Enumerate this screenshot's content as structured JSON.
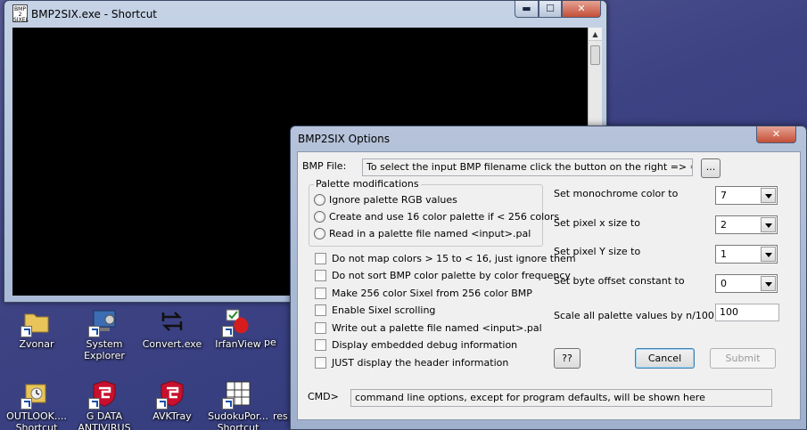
{
  "desktop": {
    "icons": [
      {
        "label": "Zvonar"
      },
      {
        "label": "System Explorer"
      },
      {
        "label": "Convert.exe"
      },
      {
        "label": "IrfanView"
      },
      {
        "label": "OUTLOOK.... Shortcut"
      },
      {
        "label": "G DATA ANTIVIRUS"
      },
      {
        "label": "AVKTray"
      },
      {
        "label": "SudokuPor... Shortcut"
      }
    ],
    "partial_labels": [
      "pe",
      "res",
      "Shortcut"
    ]
  },
  "console_window": {
    "title": "BMP2SIX.exe - Shortcut",
    "app_icon_text": "BMP 2 SIXEL",
    "min_glyph": "▬",
    "max_glyph": "☐",
    "close_glyph": "✕"
  },
  "dialog": {
    "title": "BMP2SIX Options",
    "close_glyph": "✕",
    "bmp_file": {
      "label": "BMP File:",
      "value": "To select the input BMP filename click the button on the right => =>",
      "browse_label": "..."
    },
    "palette_group": {
      "title": "Palette modifications",
      "options": [
        {
          "label": "Ignore palette RGB values"
        },
        {
          "label": "Create and use 16 color palette if < 256 colors"
        },
        {
          "label": "Read in a palette file named <input>.pal"
        }
      ]
    },
    "checkboxes": [
      {
        "label": "Do not map colors > 15 to < 16, just ignore them"
      },
      {
        "label": "Do not sort BMP color palette by color frequency"
      },
      {
        "label": "Make 256 color Sixel from 256 color BMP"
      },
      {
        "label": "Enable Sixel scrolling"
      },
      {
        "label": "Write out a palette file named <input>.pal"
      },
      {
        "label": "Display embedded debug information"
      },
      {
        "label": "JUST display the header information"
      }
    ],
    "settings": [
      {
        "label": "Set monochrome color to",
        "value": "7"
      },
      {
        "label": "Set pixel x size to",
        "value": "2"
      },
      {
        "label": "Set pixel Y size to",
        "value": "1"
      },
      {
        "label": "Set byte offset constant to",
        "value": "0"
      }
    ],
    "scale": {
      "label": "Scale all palette values by n/100",
      "value": "100"
    },
    "buttons": {
      "help": "??",
      "cancel": "Cancel",
      "submit": "Submit"
    },
    "cmd": {
      "label": "CMD>",
      "value": "command line options, except for program defaults, will be shown here"
    }
  }
}
